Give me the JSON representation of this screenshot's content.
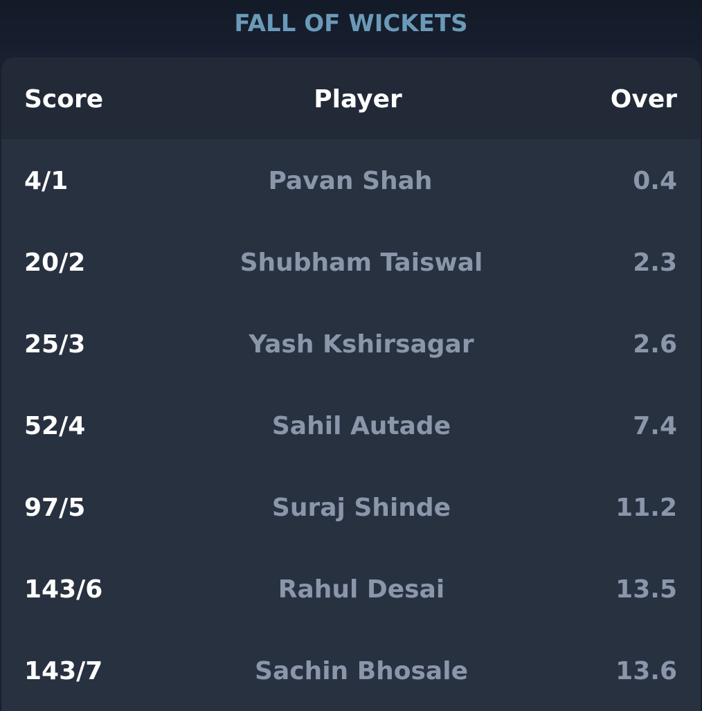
{
  "title": "FALL OF WICKETS",
  "table": {
    "headers": {
      "score": "Score",
      "player": "Player",
      "over": "Over"
    },
    "rows": [
      {
        "score": "4/1",
        "player": "Pavan Shah",
        "over": "0.4"
      },
      {
        "score": "20/2",
        "player": "Shubham Taiswal",
        "over": "2.3"
      },
      {
        "score": "25/3",
        "player": "Yash Kshirsagar",
        "over": "2.6"
      },
      {
        "score": "52/4",
        "player": "Sahil Autade",
        "over": "7.4"
      },
      {
        "score": "97/5",
        "player": "Suraj Shinde",
        "over": "11.2"
      },
      {
        "score": "143/6",
        "player": "Rahul Desai",
        "over": "13.5"
      },
      {
        "score": "143/7",
        "player": "Sachin Bhosale",
        "over": "13.6"
      }
    ]
  },
  "colors": {
    "background": "#182031",
    "card": "#283140",
    "header_row": "#222a38",
    "title": "#6a9ab8",
    "text_primary": "#ffffff",
    "text_secondary": "#8b96ab"
  }
}
